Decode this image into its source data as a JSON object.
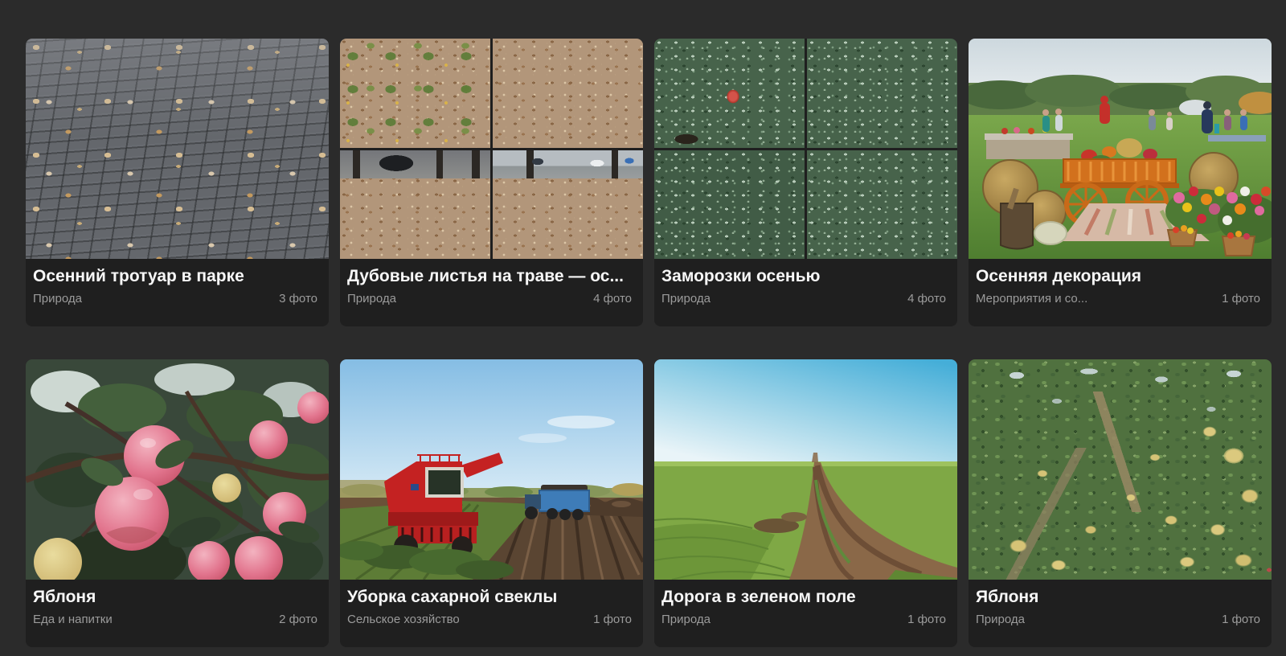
{
  "page": {
    "background_color": "#2b2b2b",
    "card_background_color": "#1f1f1f",
    "title_color": "#f7f7f7",
    "muted_text_color": "#9b9b9b"
  },
  "albums": [
    {
      "title": "Осенний тротуар в парке",
      "category": "Природа",
      "count": "3 фото",
      "image_alt": "fallen-leaves-on-paved-sidewalk"
    },
    {
      "title": "Дубовые листья на траве — ос...",
      "category": "Природа",
      "count": "4 фото",
      "image_alt": "oak-leaves-on-grass-collage-4"
    },
    {
      "title": "Заморозки осенью",
      "category": "Природа",
      "count": "4 фото",
      "image_alt": "frosted-strawberry-plants-collage-4"
    },
    {
      "title": "Осенняя декорация",
      "category": "Мероприятия и со...",
      "count": "1 фото",
      "image_alt": "autumn-fair-with-orange-cart-flowers-hay"
    },
    {
      "title": "Яблоня",
      "category": "Еда и напитки",
      "count": "2 фото",
      "image_alt": "pink-apples-on-branches"
    },
    {
      "title": "Уборка сахарной свеклы",
      "category": "Сельское хозяйство",
      "count": "1 фото",
      "image_alt": "red-beet-harvester-and-blue-trailer-in-field"
    },
    {
      "title": "Дорога в зеленом поле",
      "category": "Природа",
      "count": "1 фото",
      "image_alt": "dirt-road-curving-through-green-field"
    },
    {
      "title": "Яблоня",
      "category": "Природа",
      "count": "1 фото",
      "image_alt": "tree-full-of-small-yellow-apples"
    }
  ]
}
